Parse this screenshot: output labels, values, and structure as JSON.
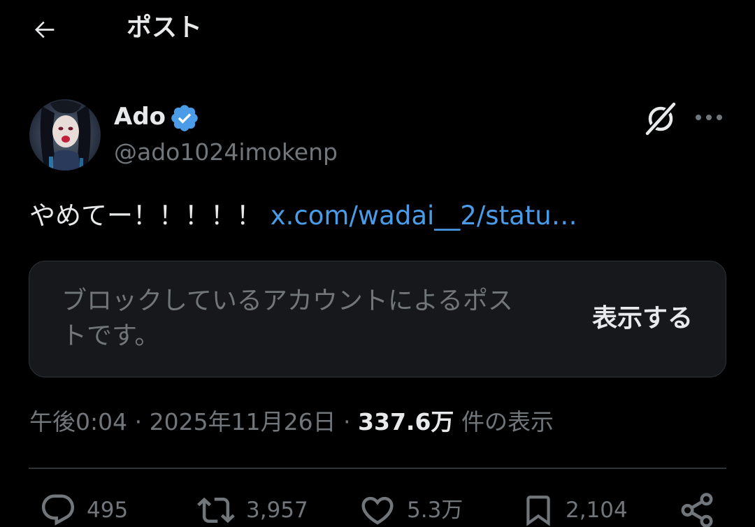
{
  "header": {
    "title": "ポスト",
    "back_icon": "arrow-left-icon"
  },
  "post": {
    "author": {
      "name": "Ado",
      "handle": "@ado1024imokenp",
      "verified": true,
      "verified_color": "#4a9ce8"
    },
    "text": "やめてー！！！！！",
    "link": "x.com/wadai__2/statu…",
    "quoted": {
      "message": "ブロックしているアカウントによるポストです。",
      "show_label": "表示する"
    },
    "meta": {
      "time": "午後0:04",
      "date": "2025年11月26日",
      "views": "337.6万",
      "views_suffix": "件の表示"
    }
  },
  "actions": {
    "reply_count": "495",
    "repost_count": "3,957",
    "like_count": "5.3万",
    "bookmark_count": "2,104"
  },
  "colors": {
    "background": "#000000",
    "text": "#e7e9ea",
    "secondary": "#71767b",
    "link": "#4a9ce8",
    "card_bg": "#16181c",
    "border": "#2f3336"
  }
}
